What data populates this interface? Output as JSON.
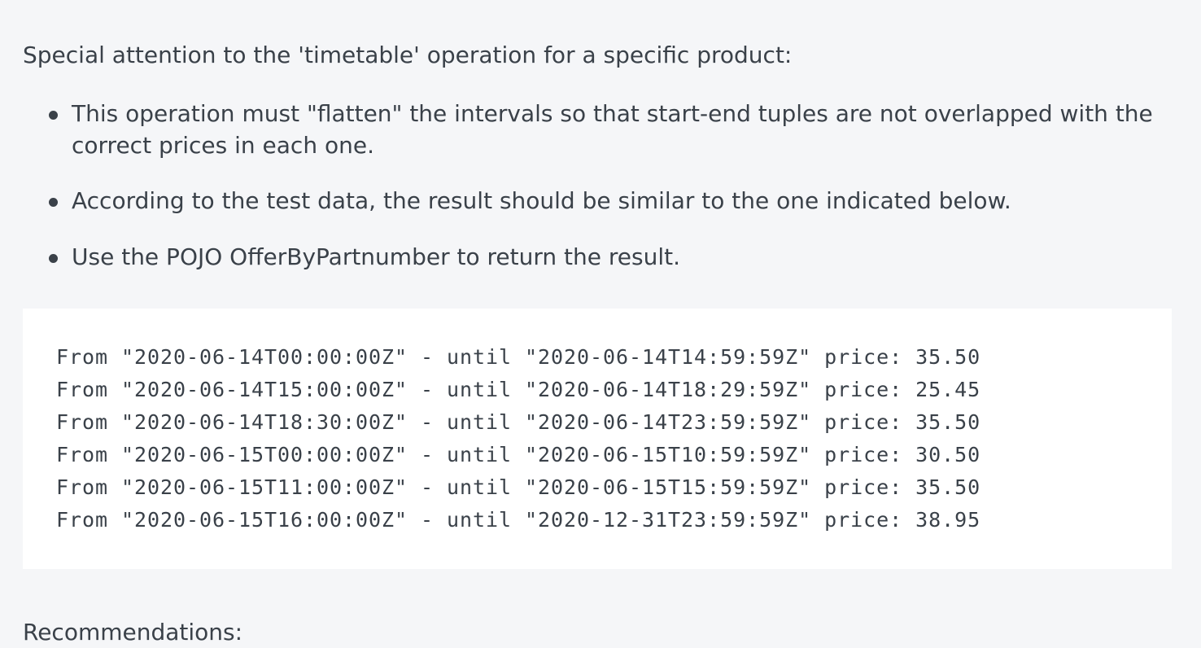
{
  "intro": "Special attention to the 'timetable' operation for a specific product:",
  "bullets": [
    "This operation must \"flatten\" the intervals so that start-end tuples are not overlapped with the correct prices in each one.",
    "According to the test data, the result should be similar to the one indicated below.",
    "Use the POJO OfferByPartnumber to return the result."
  ],
  "code_lines": [
    "From \"2020-06-14T00:00:00Z\" - until \"2020-06-14T14:59:59Z\" price: 35.50",
    "From \"2020-06-14T15:00:00Z\" - until \"2020-06-14T18:29:59Z\" price: 25.45",
    "From \"2020-06-14T18:30:00Z\" - until \"2020-06-14T23:59:59Z\" price: 35.50",
    "From \"2020-06-15T00:00:00Z\" - until \"2020-06-15T10:59:59Z\" price: 30.50",
    "From \"2020-06-15T11:00:00Z\" - until \"2020-06-15T15:59:59Z\" price: 35.50",
    "From \"2020-06-15T16:00:00Z\" - until \"2020-12-31T23:59:59Z\" price: 38.95"
  ],
  "next_section_heading": "Recommendations:",
  "colors": {
    "page_background": "#f5f6f8",
    "text": "#3a4149",
    "code_background": "#ffffff"
  }
}
